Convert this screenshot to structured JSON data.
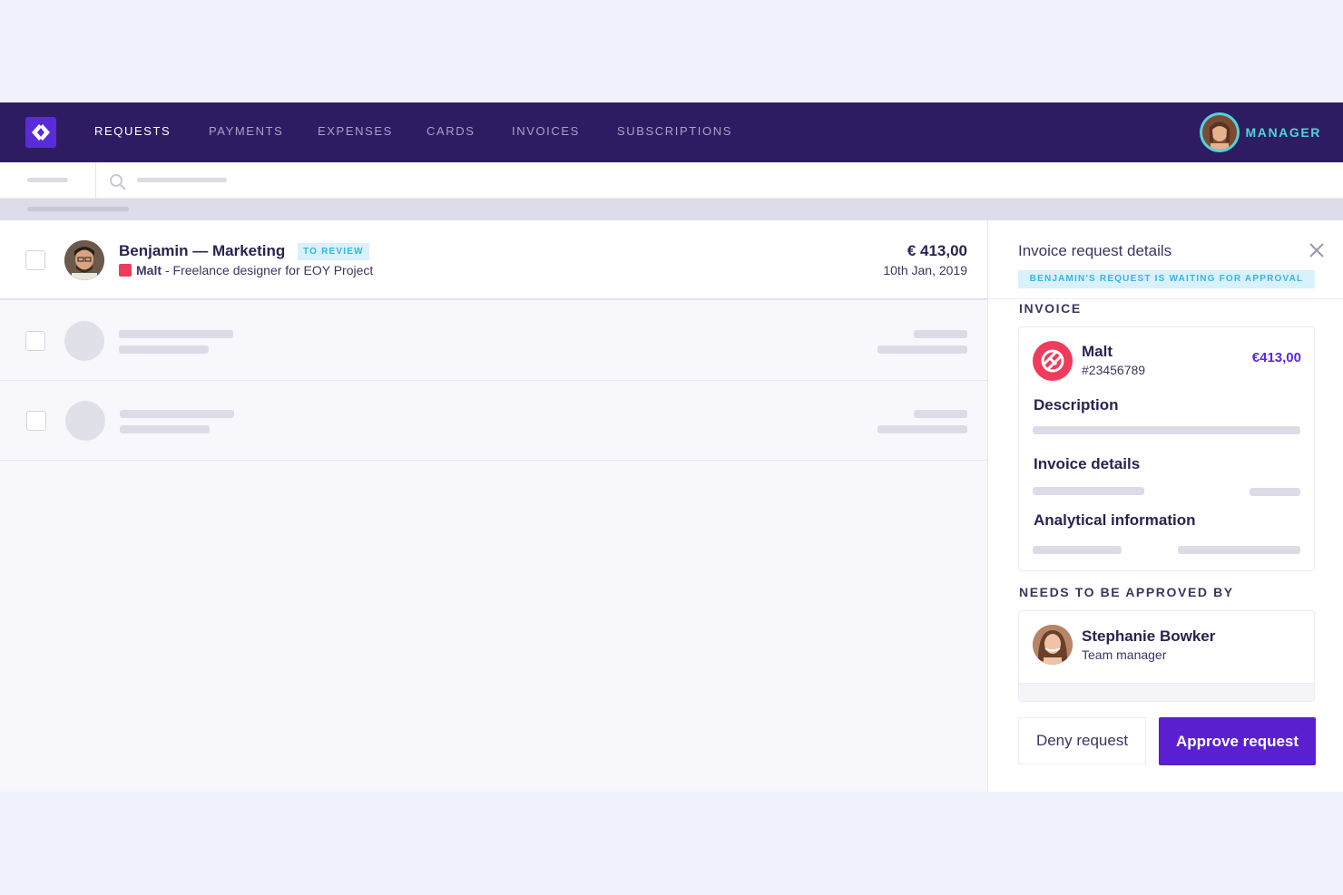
{
  "nav": {
    "items": [
      {
        "label": "REQUESTS",
        "active": true
      },
      {
        "label": "PAYMENTS",
        "active": false
      },
      {
        "label": "EXPENSES",
        "active": false
      },
      {
        "label": "CARDS",
        "active": false
      },
      {
        "label": "INVOICES",
        "active": false
      },
      {
        "label": "SUBSCRIPTIONS",
        "active": false
      }
    ],
    "user_role": "MANAGER"
  },
  "list": {
    "rows": [
      {
        "title": "Benjamin — Marketing",
        "badge": "TO REVIEW",
        "vendor": "Malt",
        "subtitle": "- Freelance designer for EOY Project",
        "amount": "€ 413,00",
        "date": "10th Jan, 2019"
      }
    ]
  },
  "panel": {
    "title": "Invoice request details",
    "status": "BENJAMIN'S REQUEST IS WAITING FOR APPROVAL",
    "invoice_label": "INVOICE",
    "invoice": {
      "vendor": "Malt",
      "number": "#23456789",
      "amount": "€413,00",
      "description_heading": "Description",
      "details_heading": "Invoice details",
      "analytics_heading": "Analytical information"
    },
    "approval_label": "NEEDS TO BE APPROVED BY",
    "approver": {
      "name": "Stephanie Bowker",
      "role": "Team manager"
    },
    "deny_label": "Deny request",
    "approve_label": "Approve request"
  },
  "colors": {
    "nav_bg": "#2e1c63",
    "accent": "#5a1fd1",
    "badge_text": "#33b6e3",
    "badge_bg": "#d9f1fb",
    "brand_malt": "#ef3b5c",
    "manager_accent": "#4fd3d8"
  },
  "icons": [
    "logo-icon",
    "search-icon",
    "close-icon",
    "malt-logo-icon"
  ]
}
